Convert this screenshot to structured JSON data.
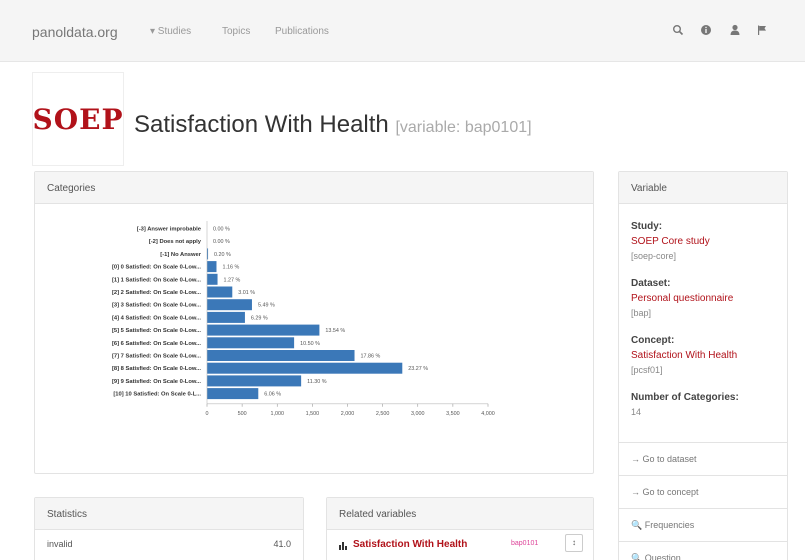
{
  "navbar": {
    "brand": "panoldata.org",
    "items": [
      "▾ Studies",
      "Topics",
      "Publications"
    ],
    "icons": [
      "search-icon",
      "info-icon",
      "user-icon",
      "flag-icon"
    ]
  },
  "header": {
    "logo": "SOEP",
    "title": "Satisfaction With Health",
    "subtitle": "[variable: bap0101]"
  },
  "categories_panel": {
    "heading": "Categories"
  },
  "chart_data": {
    "type": "bar",
    "orientation": "horizontal",
    "categories": [
      "[-3] Answer improbable",
      "[-2] Does not apply",
      "[-1] No Answer",
      "[0] 0 Satisfied: On Scale 0-Low...",
      "[1] 1 Satisfied: On Scale 0-Low...",
      "[2] 2 Satisfied: On Scale 0-Low...",
      "[3] 3 Satisfied: On Scale 0-Low...",
      "[4] 4 Satisfied: On Scale 0-Low...",
      "[5] 5 Satisfied: On Scale 0-Low...",
      "[6] 6 Satisfied: On Scale 0-Low...",
      "[7] 7 Satisfied: On Scale 0-Low...",
      "[8] 8 Satisfied: On Scale 0-Low...",
      "[9] 9 Satisfied: On Scale 0-Low...",
      "[10] 10 Satisfied: On Scale 0-L..."
    ],
    "values": [
      0,
      0,
      15,
      135,
      150,
      360,
      640,
      540,
      1600,
      1240,
      2100,
      2780,
      1340,
      730
    ],
    "value_labels": [
      "0.00 %",
      "0.00 %",
      "0.20 %",
      "1.16 %",
      "1.27 %",
      "3.01 %",
      "5.49 %",
      "6.29 %",
      "13.54 %",
      "10.50 %",
      "17.86 %",
      "23.27 %",
      "11.30 %",
      "6.06 %"
    ],
    "xlim": [
      0,
      4000
    ],
    "ticks": [
      "0",
      "500",
      "1,000",
      "1,500",
      "2,000",
      "2,500",
      "3,000",
      "3,500",
      "4,000"
    ],
    "bar_color": "#3b78b8"
  },
  "variable_panel": {
    "heading": "Variable",
    "study_label": "Study:",
    "study_value": "SOEP Core study",
    "study_code": "[soep-core]",
    "dataset_label": "Dataset:",
    "dataset_value": "Personal questionnaire",
    "dataset_code": "[bap]",
    "concept_label": "Concept:",
    "concept_value": "Satisfaction With Health",
    "concept_code": "[pcsf01]",
    "ncat_label": "Number of Categories:",
    "ncat_value": "14",
    "actions": [
      "→ Go to dataset",
      "→ Go to concept",
      "🔍 Frequencies",
      "🔍 Question"
    ]
  },
  "statistics_panel": {
    "heading": "Statistics",
    "rows": [
      {
        "label": "invalid",
        "value": "41.0"
      }
    ]
  },
  "related_panel": {
    "heading": "Related variables",
    "items": [
      {
        "name": "Satisfaction With Health",
        "code": "bap0101",
        "button": "↕"
      }
    ]
  }
}
